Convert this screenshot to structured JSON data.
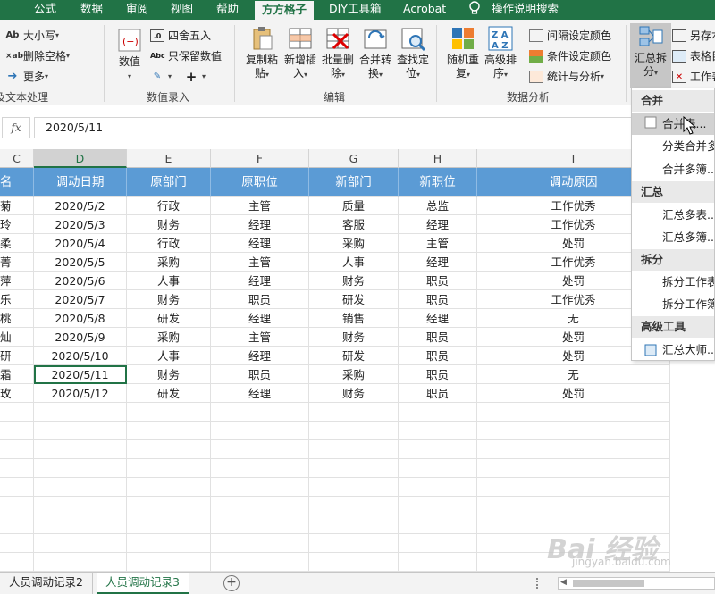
{
  "ribbon_tabs": [
    {
      "label": "公式",
      "active": false
    },
    {
      "label": "数据",
      "active": false
    },
    {
      "label": "审阅",
      "active": false
    },
    {
      "label": "视图",
      "active": false
    },
    {
      "label": "帮助",
      "active": false
    },
    {
      "label": "方方格子",
      "active": true
    },
    {
      "label": "DIY工具箱",
      "active": false
    },
    {
      "label": "Acrobat",
      "active": false
    },
    {
      "label": "操作说明搜索",
      "active": false
    }
  ],
  "ribbon": {
    "text_group": {
      "label": "及文本处理",
      "case_label": "大小写",
      "delete_spaces_label": "删除空格",
      "more_label": "更多"
    },
    "number_group": {
      "label": "数值录入",
      "value_label": "数值",
      "round_label": "四舍五入",
      "keep_value_label": "只保留数值"
    },
    "edit_group": {
      "label": "编辑",
      "copy_paste_label": "复制粘贴",
      "insert_label": "新增插入",
      "batch_delete_label": "批量删除",
      "merge_convert_label": "合并转换",
      "find_locate_label": "查找定位"
    },
    "analysis_group": {
      "label": "数据分析",
      "random_repeat_label": "随机重复",
      "advanced_sort_label": "高级排序",
      "interval_color_label": "间隔设定颜色",
      "cond_color_label": "条件设定颜色",
      "stats_label": "统计与分析"
    },
    "summary_split_label": "汇总拆分",
    "save_as_label": "另存本",
    "table_label": "表格目",
    "work_label": "工作表"
  },
  "formula_bar": {
    "fx_label": "fx",
    "value": "2020/5/11"
  },
  "columns": [
    {
      "letter": "C",
      "selected": false
    },
    {
      "letter": "D",
      "selected": true
    },
    {
      "letter": "E",
      "selected": false
    },
    {
      "letter": "F",
      "selected": false
    },
    {
      "letter": "G",
      "selected": false
    },
    {
      "letter": "H",
      "selected": false
    },
    {
      "letter": "I",
      "selected": false
    }
  ],
  "table": {
    "headers": [
      "名",
      "调动日期",
      "原部门",
      "原职位",
      "新部门",
      "新职位",
      "调动原因"
    ],
    "rows": [
      [
        "菊",
        "2020/5/2",
        "行政",
        "主管",
        "质量",
        "总监",
        "工作优秀"
      ],
      [
        "玲",
        "2020/5/3",
        "财务",
        "经理",
        "客服",
        "经理",
        "工作优秀"
      ],
      [
        "柔",
        "2020/5/4",
        "行政",
        "经理",
        "采购",
        "主管",
        "处罚"
      ],
      [
        "菁",
        "2020/5/5",
        "采购",
        "主管",
        "人事",
        "经理",
        "工作优秀"
      ],
      [
        "萍",
        "2020/5/6",
        "人事",
        "经理",
        "财务",
        "职员",
        "处罚"
      ],
      [
        "乐",
        "2020/5/7",
        "财务",
        "职员",
        "研发",
        "职员",
        "工作优秀"
      ],
      [
        "桃",
        "2020/5/8",
        "研发",
        "经理",
        "销售",
        "经理",
        "无"
      ],
      [
        "灿",
        "2020/5/9",
        "采购",
        "主管",
        "财务",
        "职员",
        "处罚"
      ],
      [
        "研",
        "2020/5/10",
        "人事",
        "经理",
        "研发",
        "职员",
        "处罚"
      ],
      [
        "霜",
        "2020/5/11",
        "财务",
        "职员",
        "采购",
        "职员",
        "无"
      ],
      [
        "玫",
        "2020/5/12",
        "研发",
        "经理",
        "财务",
        "职员",
        "处罚"
      ]
    ],
    "selected_row": 9
  },
  "menu": {
    "sections": [
      {
        "title": "合并",
        "items": [
          "合并表...",
          "分类合并多",
          "合并多簿..."
        ]
      },
      {
        "title": "汇总",
        "items": [
          "汇总多表...",
          "汇总多簿..."
        ]
      },
      {
        "title": "拆分",
        "items": [
          "拆分工作表",
          "拆分工作簿"
        ]
      },
      {
        "title": "高级工具",
        "items": [
          "汇总大师..."
        ]
      }
    ],
    "highlighted": "合并表..."
  },
  "sheet_tabs": [
    {
      "label": "人员调动记录2",
      "active": false
    },
    {
      "label": "人员调动记录3",
      "active": true
    }
  ],
  "add_sheet_label": "+",
  "watermark": {
    "text": "Bai 经验",
    "sub": "jingyan.baidu.com"
  },
  "colors": {
    "excel_green": "#217346",
    "header_blue": "#5b9bd5"
  }
}
